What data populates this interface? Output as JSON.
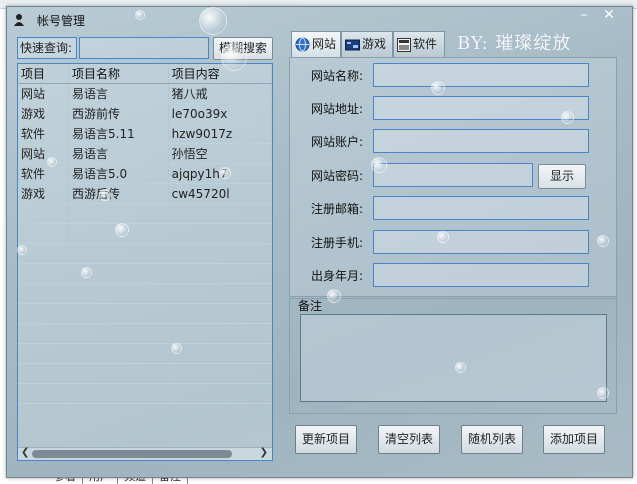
{
  "window": {
    "title": "帐号管理",
    "minimize_label": "–",
    "close_label": "✕"
  },
  "left": {
    "search_label": "快速查询:",
    "search_value": "",
    "fuzzy_search_button": "模糊搜索",
    "columns": [
      "项目",
      "项目名称",
      "项目内容"
    ],
    "rows": [
      [
        "网站",
        "易语言",
        "猪八戒"
      ],
      [
        "游戏",
        "西游前传",
        "le70o39x"
      ],
      [
        "软件",
        "易语言5.11",
        "hzw9017z"
      ],
      [
        "网站",
        "易语言",
        "孙悟空"
      ],
      [
        "软件",
        "易语言5.0",
        "ajqpy1h7"
      ],
      [
        "游戏",
        "西游后传",
        "cw45720l"
      ]
    ],
    "scroll_left_glyph": "❮",
    "scroll_right_glyph": "❯"
  },
  "tabs": [
    {
      "label": "网站",
      "icon": "globe-icon",
      "active": true
    },
    {
      "label": "游戏",
      "icon": "game-icon",
      "active": false
    },
    {
      "label": "软件",
      "icon": "software-icon",
      "active": false
    }
  ],
  "byline": "BY: 璀璨绽放",
  "form": {
    "fields": [
      {
        "label": "网站名称:",
        "value": ""
      },
      {
        "label": "网站地址:",
        "value": ""
      },
      {
        "label": "网站账户:",
        "value": ""
      },
      {
        "label": "网站密码:",
        "value": ""
      },
      {
        "label": "注册邮箱:",
        "value": ""
      },
      {
        "label": "注册手机:",
        "value": ""
      },
      {
        "label": "出身年月:",
        "value": ""
      }
    ],
    "show_button": "显示"
  },
  "notes": {
    "label": "备注",
    "value": ""
  },
  "actions": {
    "update": "更新项目",
    "clear": "清空列表",
    "random": "随机列表",
    "add": "添加项目"
  },
  "background": {
    "bottom_tabs": [
      "参看",
      "用户",
      "频道",
      "备注"
    ]
  },
  "colors": {
    "accent_border": "#4a86c5",
    "window_bg": "#a9bdc8"
  }
}
